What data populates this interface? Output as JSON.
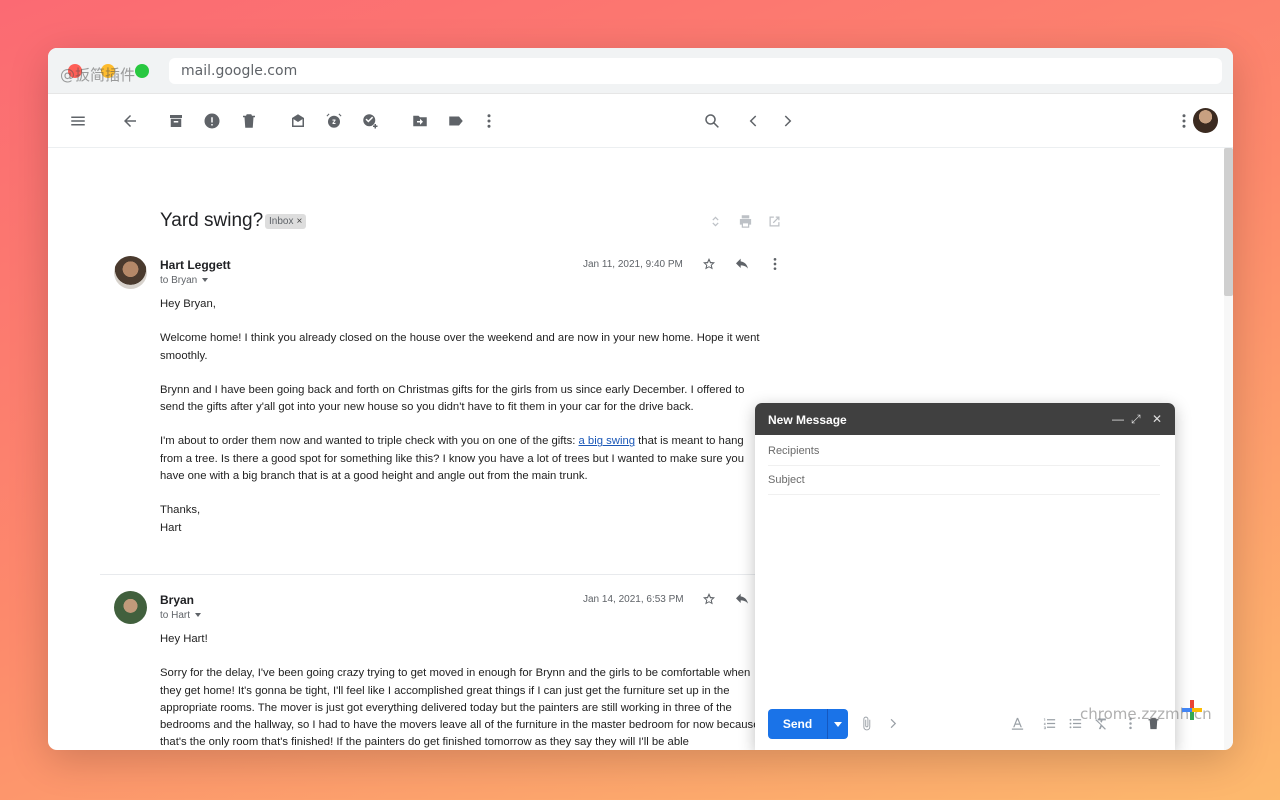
{
  "browser": {
    "url": "mail.google.com",
    "watermark_top": "@扳简插件",
    "watermark_bottom": "chrome.zzzmh.cn"
  },
  "toolbar": {
    "icons": [
      "menu-icon",
      "back-arrow-icon",
      "archive-icon",
      "report-spam-icon",
      "delete-icon",
      "mark-unread-icon",
      "snooze-icon",
      "add-to-tasks-icon",
      "move-to-icon",
      "label-icon",
      "more-vert-icon",
      "search-icon",
      "chevron-left-icon",
      "chevron-right-icon",
      "more-vert-icon"
    ]
  },
  "thread": {
    "subject": "Yard swing?",
    "label": "Inbox",
    "label_remove": "×"
  },
  "messages": [
    {
      "sender": "Hart Leggett",
      "to": "to Bryan",
      "date": "Jan 11, 2021, 9:40 PM",
      "greeting": "Hey Bryan,",
      "p1": "Welcome home! I think you already closed on the house over the weekend and are now in your new home. Hope it went smoothly.",
      "p2": "Brynn and I have been going back and forth on Christmas gifts for the girls from us since early December. I offered to send the gifts after y'all got into your new house so you didn't have to fit them in your car for the drive back.",
      "p3_before": "I'm about to order them now and wanted to triple check with you on one of the gifts: ",
      "p3_link": "a big swing",
      "p3_after": " that is meant to hang from a tree. Is there a good spot for something like this? I know you have a lot of trees but I wanted to make sure you have one with a big branch that is at a good height and angle out from the main trunk.",
      "signoff": "Thanks,",
      "signature": "Hart"
    },
    {
      "sender": "Bryan",
      "to": "to Hart",
      "date": "Jan 14, 2021, 6:53 PM",
      "greeting": "Hey Hart!",
      "p1": "Sorry for the delay, I've been going crazy trying to get moved in enough for Brynn and the girls to be comfortable when they get home! It's gonna be tight, I'll feel like I accomplished great things if I can just get the furniture set up in the appropriate rooms. The mover is just got everything delivered today but the painters are still working in three of the bedrooms and the hallway, so I had to have the movers leave all of the furniture in the master bedroom for now because that's the only room that's finished! If the painters do get finished tomorrow as they say they will I'll be able"
    }
  ],
  "compose": {
    "title": "New Message",
    "recipients_placeholder": "Recipients",
    "subject_placeholder": "Subject",
    "send_label": "Send"
  },
  "colors": {
    "accent": "#1a73e8",
    "compose_header": "#404040",
    "link": "#1a57b7"
  }
}
